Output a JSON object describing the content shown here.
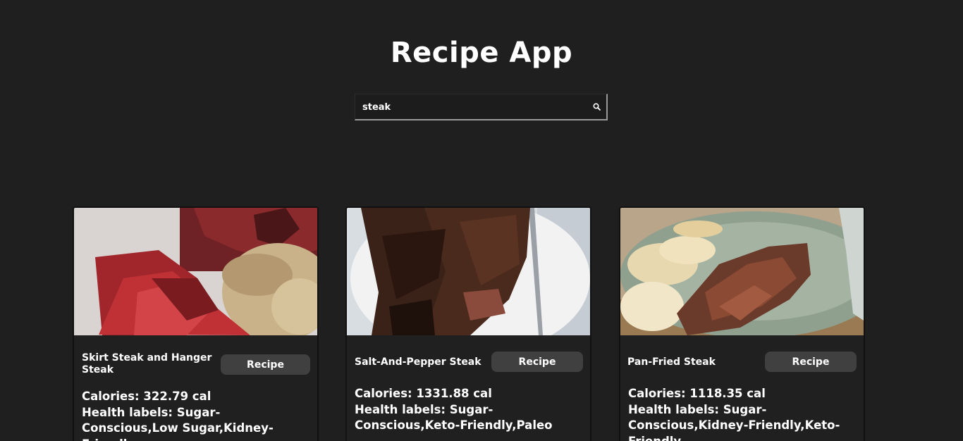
{
  "header": {
    "title": "Recipe App"
  },
  "search": {
    "value": "steak",
    "icon": "search-icon"
  },
  "recipe_button_label": "Recipe",
  "recipes": [
    {
      "name": "Skirt Steak and Hanger Steak",
      "calories": "Calories: 322.79 cal",
      "health_labels": "Health labels: Sugar-Conscious,Low Sugar,Kidney-Friendly"
    },
    {
      "name": "Salt-And-Pepper Steak",
      "calories": "Calories: 1331.88 cal",
      "health_labels": "Health labels: Sugar-Conscious,Keto-Friendly,Paleo"
    },
    {
      "name": "Pan-Fried Steak",
      "calories": "Calories: 1118.35 cal",
      "health_labels": "Health labels: Sugar-Conscious,Kidney-Friendly,Keto-Friendly"
    }
  ],
  "colors": {
    "background": "#1f1f1f",
    "card": "#202020",
    "button": "#404040",
    "text": "#ffffff"
  }
}
